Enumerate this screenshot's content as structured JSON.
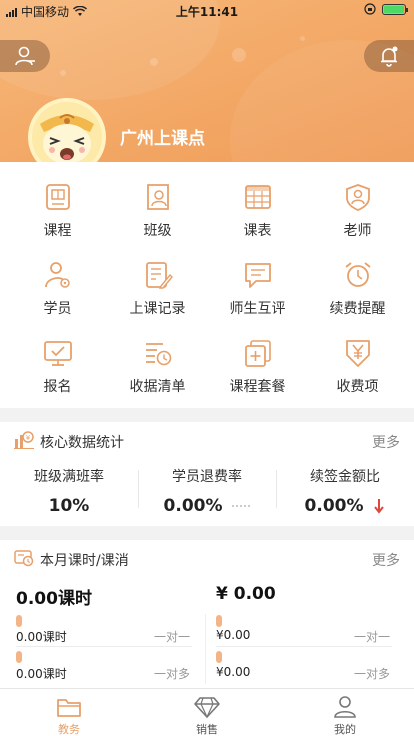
{
  "status_bar": {
    "carrier": "中国移动",
    "time": "上午11:41"
  },
  "header": {
    "school_name": "广州上课点"
  },
  "menu": [
    {
      "label": "课程",
      "icon": "book-icon"
    },
    {
      "label": "班级",
      "icon": "class-profile-icon"
    },
    {
      "label": "课表",
      "icon": "timetable-icon"
    },
    {
      "label": "老师",
      "icon": "teacher-icon"
    },
    {
      "label": "学员",
      "icon": "student-icon"
    },
    {
      "label": "上课记录",
      "icon": "record-edit-icon"
    },
    {
      "label": "师生互评",
      "icon": "comment-icon"
    },
    {
      "label": "续费提醒",
      "icon": "alarm-clock-icon"
    },
    {
      "label": "报名",
      "icon": "monitor-check-icon"
    },
    {
      "label": "收据清单",
      "icon": "receipt-list-icon"
    },
    {
      "label": "课程套餐",
      "icon": "package-icon"
    },
    {
      "label": "收费项",
      "icon": "yen-tag-icon"
    }
  ],
  "core_stats": {
    "title": "核心数据统计",
    "more": "更多",
    "items": [
      {
        "title": "班级满班率",
        "value": "10%"
      },
      {
        "title": "学员退费率",
        "value": "0.00%"
      },
      {
        "title": "续签金额比",
        "value": "0.00%"
      }
    ]
  },
  "monthly": {
    "title": "本月课时/课消",
    "more": "更多",
    "hours_total": "0.00课时",
    "amount_total": "¥ 0.00",
    "rows": [
      {
        "hours": "0.00课时",
        "hours_type": "一对一",
        "amount": "¥0.00",
        "amount_type": "一对一"
      },
      {
        "hours": "0.00课时",
        "hours_type": "一对多",
        "amount": "¥0.00",
        "amount_type": "一对多"
      }
    ]
  },
  "tabs": [
    {
      "label": "教务",
      "icon": "folder-icon",
      "active": true
    },
    {
      "label": "销售",
      "icon": "diamond-icon",
      "active": false
    },
    {
      "label": "我的",
      "icon": "person-icon",
      "active": false
    }
  ],
  "colors": {
    "accent": "#f3a866",
    "icon_orange": "#e8a06a",
    "down_arrow": "#e0463a"
  }
}
